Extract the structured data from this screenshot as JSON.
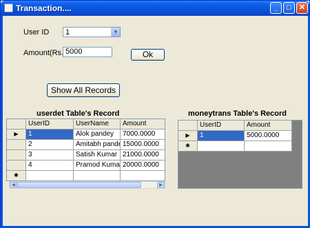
{
  "window": {
    "title": "Transaction...."
  },
  "form": {
    "userid_label": "User ID",
    "userid_value": "1",
    "amount_label": "Amount(Rs.)",
    "amount_value": "5000",
    "ok_label": "Ok",
    "show_all_label": "Show All Records"
  },
  "userdet": {
    "title": "userdet Table's Record",
    "columns": [
      "UserID",
      "UserName",
      "Amount"
    ],
    "rows": [
      [
        "1",
        "Alok pandey",
        "7000.0000"
      ],
      [
        "2",
        "Amitabh pandey",
        "15000.0000"
      ],
      [
        "3",
        "Satish Kumar",
        "21000.0000"
      ],
      [
        "4",
        "Pramod Kumar",
        "20000.0000"
      ]
    ]
  },
  "moneytrans": {
    "title": "moneytrans Table's Record",
    "columns": [
      "UserID",
      "Amount"
    ],
    "rows": [
      [
        "1",
        "5000.0000"
      ]
    ]
  },
  "icons": {
    "current_row": "▶",
    "new_row": "✱",
    "minimize": "_",
    "maximize": "□",
    "close": "✕",
    "dropdown": "▼",
    "scroll_left": "◀",
    "scroll_right": "▶"
  }
}
